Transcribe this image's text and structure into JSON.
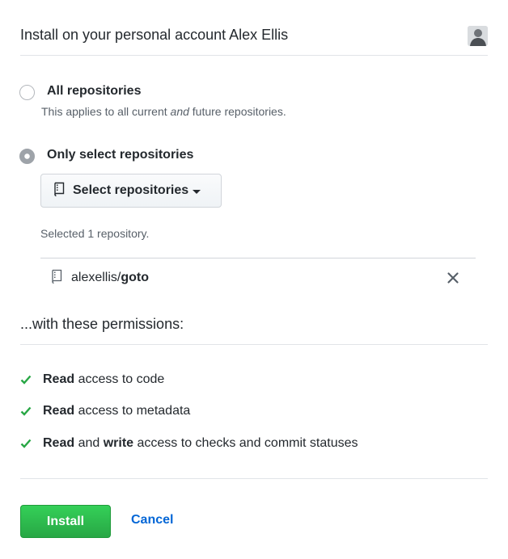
{
  "header": {
    "title": "Install on your personal account Alex Ellis"
  },
  "options": {
    "all": {
      "title": "All repositories",
      "desc_pre": "This applies to all current ",
      "desc_em": "and",
      "desc_post": " future repositories."
    },
    "select": {
      "title": "Only select repositories",
      "button_label": "Select repositories"
    }
  },
  "selected": {
    "count_text": "Selected 1 repository.",
    "repo_owner": "alexellis/",
    "repo_name": "goto"
  },
  "permissions": {
    "heading": "...with these permissions:",
    "items": [
      {
        "b1": "Read",
        "t1": " access to code",
        "b2": "",
        "t2": ""
      },
      {
        "b1": "Read",
        "t1": " access to metadata",
        "b2": "",
        "t2": ""
      },
      {
        "b1": "Read",
        "t1": " and ",
        "b2": "write",
        "t2": " access to checks and commit statuses"
      }
    ]
  },
  "footer": {
    "install_label": "Install",
    "cancel_label": "Cancel"
  },
  "colors": {
    "accent_link": "#0366d6",
    "install_green": "#28a745",
    "check_green": "#28a745"
  }
}
